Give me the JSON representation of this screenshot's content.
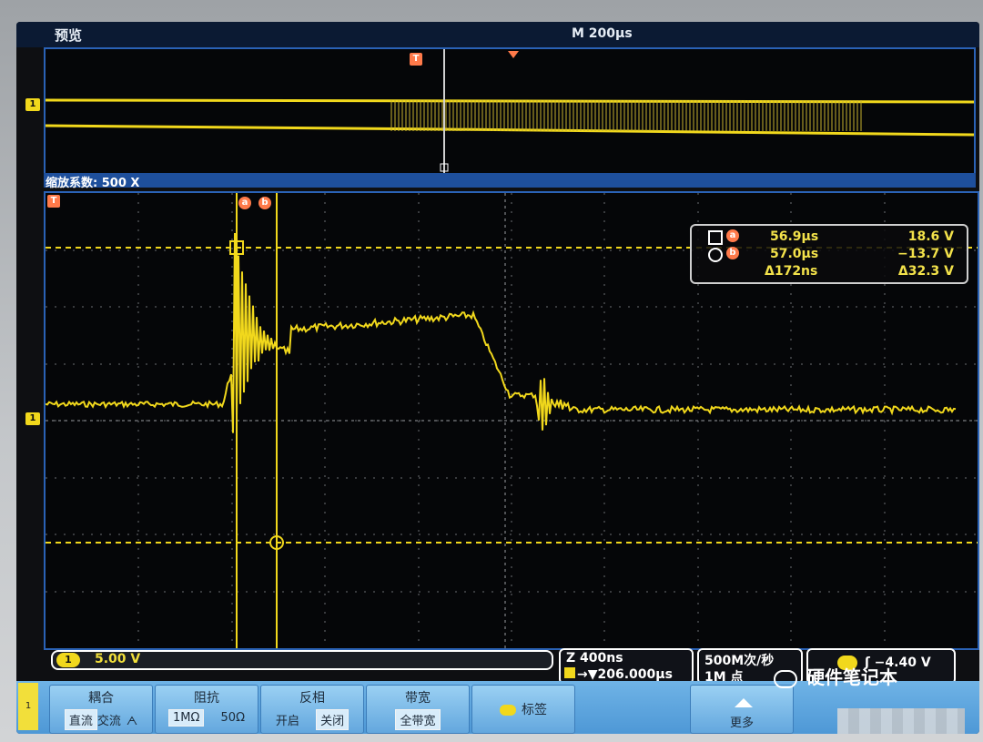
{
  "topbar": {
    "label": "预览",
    "timebase": "M 200µs"
  },
  "preview": {
    "channel_marker": "1",
    "trigger_marker": "T"
  },
  "zoom": {
    "label": "缩放系数: 500 X"
  },
  "main": {
    "channel_marker": "1",
    "trigger_marker": "T",
    "cursor_a": "a",
    "cursor_b": "b"
  },
  "readout": {
    "a": {
      "tag": "a",
      "time": "56.9µs",
      "voltage": "18.6 V"
    },
    "b": {
      "tag": "b",
      "time": "57.0µs",
      "voltage": "−13.7 V"
    },
    "delta": {
      "time": "Δ172ns",
      "voltage": "Δ32.3 V"
    }
  },
  "status": {
    "ch1_chip": "1",
    "ch1_scale": "5.00 V",
    "zoom_line1": "Z 400ns",
    "zoom_line2": "→▼206.000µs",
    "sample_line1": "500M次/秒",
    "sample_line2": "1M 点",
    "trigger_value": "ʃ −4.40 V"
  },
  "menu": {
    "side_label": "1",
    "coupling": {
      "title": "耦合",
      "opt1": "直流",
      "opt2": "交流",
      "opt3": "ᗅ"
    },
    "impedance": {
      "title": "阻抗",
      "opt1": "1MΩ",
      "opt2": "50Ω"
    },
    "invert": {
      "title": "反相",
      "opt1": "开启",
      "opt2": "关闭"
    },
    "bandwidth": {
      "title": "带宽",
      "opt1": "全带宽"
    },
    "label": {
      "title": "标签"
    },
    "more": {
      "title": "更多"
    }
  },
  "watermark": {
    "text": "硬件笔记本"
  }
}
